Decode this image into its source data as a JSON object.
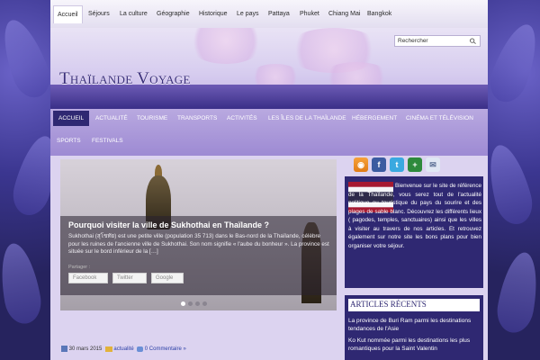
{
  "topmenu": {
    "items": [
      "Accueil",
      "Séjours",
      "La culture",
      "Géographie",
      "Historique",
      "Le pays",
      "Pattaya",
      "Phuket",
      "Chiang Mai",
      "Bangkok"
    ]
  },
  "search": {
    "value": "Rechercher"
  },
  "site": {
    "title": "Thaïlande Voyage"
  },
  "mainnav": {
    "items": [
      "Accueil",
      "Actualité",
      "Tourisme",
      "Transports",
      "Activités",
      "Les îles de la Thaïlande",
      "Hébergement",
      "Cinéma et Télévision",
      "Sports",
      "Festivals"
    ]
  },
  "slide": {
    "title": "Pourquoi visiter la ville de Sukhothai en Thaïlande ?",
    "text": "Sukhothai (สุโขทัย) est une petite ville (population 35 713) dans le Bas-nord de la Thaïlande, célèbre pour les ruines de l'ancienne ville de Sukhothai. Son nom signifie « l'aube du bonheur ». La province est située sur le bord inférieur de la […]",
    "share_label": "Partager :",
    "share_buttons": [
      "Facebook",
      "Twitter",
      "Google"
    ]
  },
  "meta": {
    "date": "30 mars 2015",
    "category": "actualité",
    "comments": "0 Commentaire »"
  },
  "social": {
    "icons": [
      "rss-icon",
      "facebook-icon",
      "twitter-icon",
      "plus-icon",
      "email-icon"
    ]
  },
  "welcome": {
    "text": "Bienvenue sur le site de référence de la Thaïlande, vous serez tout de l'actualité politique ou touristique du pays du sourire et des plages de sable blanc. Découvrez les différents lieux ( pagodes, temples, sanctuaires) ainsi que les villes à visiter au travers de nos articles. Et retrouvez également sur notre site les bons plans pour bien organiser votre séjour."
  },
  "recent": {
    "title": "Articles récents",
    "items": [
      "La province de Buri Ram parmi les destinations tendances de l'Asie",
      "Ko Kut nommée parmi les destinations les plus romantiques pour la Saint Valentin"
    ]
  },
  "colors": {
    "accent": "#2f2872",
    "nav": "#9d8ad3",
    "content": "#dcd3f0"
  }
}
